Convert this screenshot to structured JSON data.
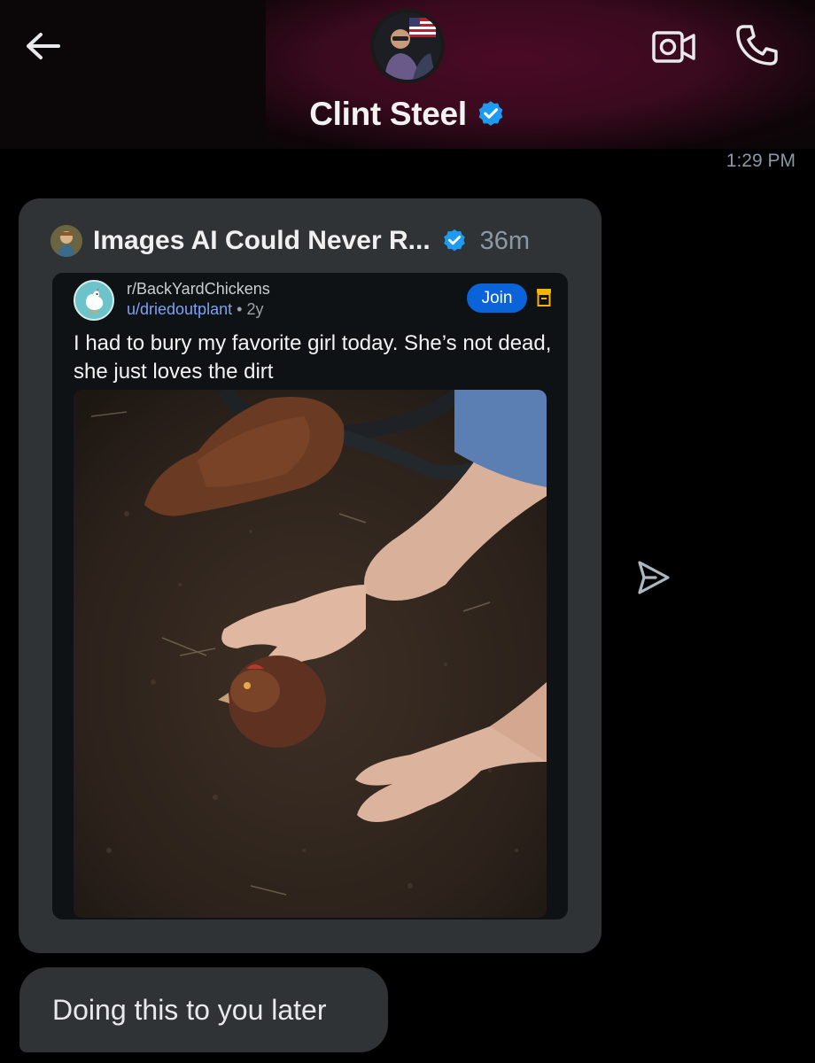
{
  "header": {
    "contact_name": "Clint Steel",
    "verified": true,
    "accent_color": "#1d9bf0"
  },
  "icons": {
    "back": "arrow-left-icon",
    "video": "video-camera-icon",
    "call": "phone-icon",
    "send": "send-icon",
    "verified": "verified-badge-icon",
    "save": "bookmark-icon"
  },
  "conversation": {
    "timestamp": "1:29 PM",
    "shared_post": {
      "account_title": "Images AI Could Never R...",
      "time_ago": "36m",
      "reddit": {
        "subreddit": "r/BackYardChickens",
        "user": "u/driedoutplant",
        "separator": "•",
        "age": "2y",
        "join_label": "Join",
        "post_title": "I had to bury my favorite girl today. She’s not dead, she just loves the dirt"
      }
    },
    "message": "Doing this to you later"
  }
}
